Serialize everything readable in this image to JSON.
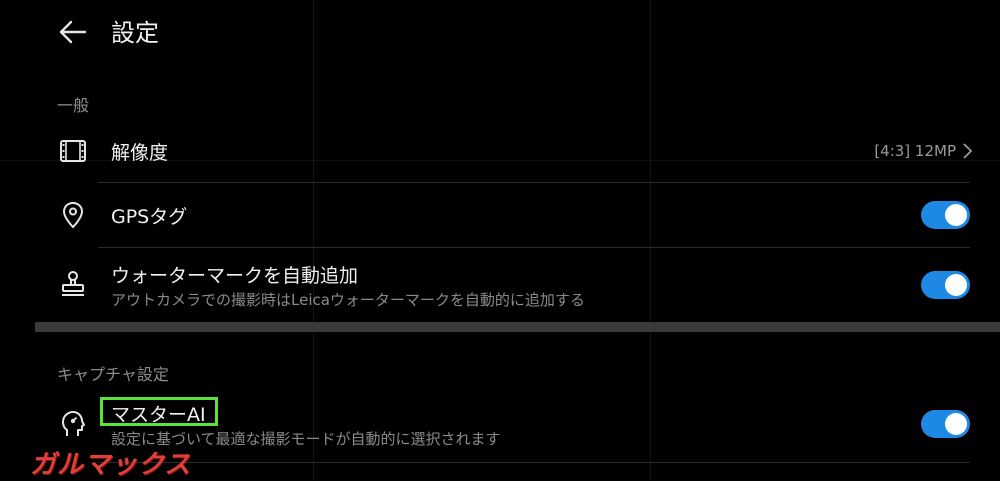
{
  "header": {
    "back_icon": "arrow-left-icon",
    "title": "設定"
  },
  "sections": {
    "general": {
      "label": "一般",
      "resolution": {
        "icon": "film-frame-icon",
        "title": "解像度",
        "value": "[4:3] 12MP",
        "chevron_icon": "chevron-right-icon"
      },
      "gps": {
        "icon": "location-pin-icon",
        "title": "GPSタグ",
        "toggle_on": true
      },
      "watermark": {
        "icon": "stamp-icon",
        "title": "ウォーターマークを自動追加",
        "subtitle": "アウトカメラでの撮影時はLeicaウォーターマークを自動的に追加する",
        "toggle_on": true
      }
    },
    "capture": {
      "label": "キャプチャ設定",
      "master_ai": {
        "icon": "ai-head-icon",
        "title": "マスターAI",
        "subtitle": "設定に基づいて最適な撮影モードが自動的に選択されます",
        "toggle_on": true
      }
    }
  },
  "colors": {
    "toggle_on": "#1e88e5",
    "highlight": "#5be33a",
    "watermark_logo": "#e0403a"
  },
  "watermark_logo_text": "ガルマックス"
}
